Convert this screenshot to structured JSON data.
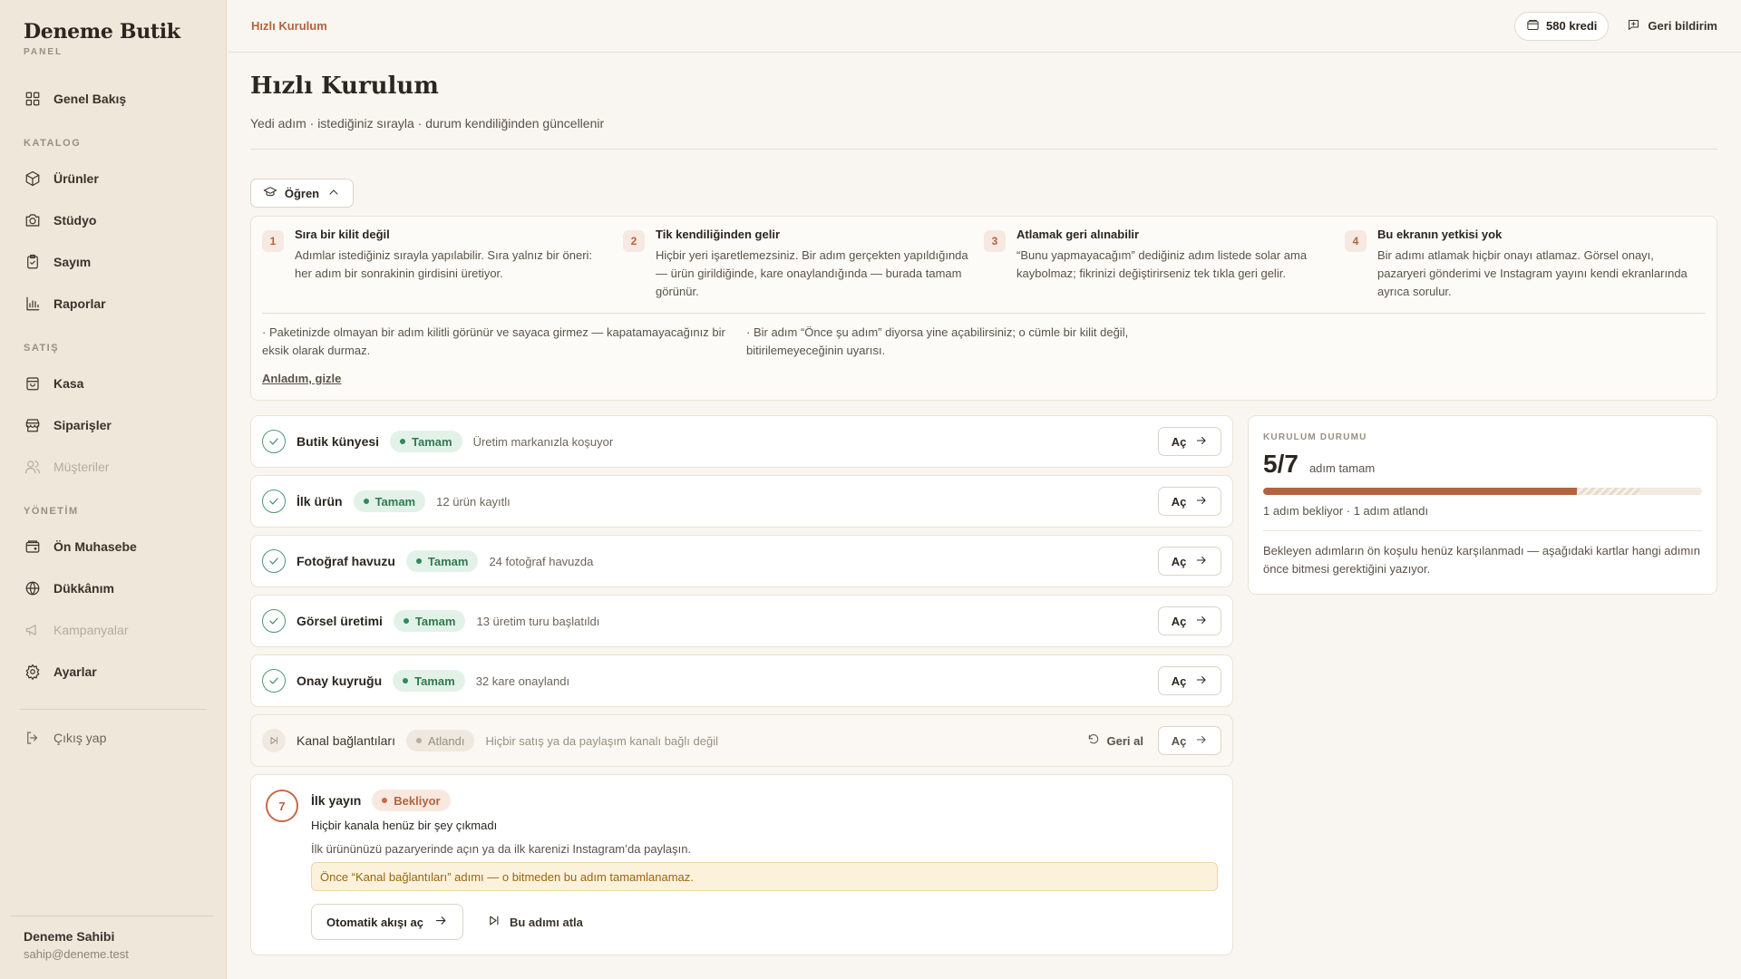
{
  "sidebar": {
    "brand_title": "Deneme Butik",
    "brand_sub": "PANEL",
    "overview": "Genel Bakış",
    "section_catalog": "KATALOG",
    "products": "Ürünler",
    "studio": "Stüdyo",
    "count": "Sayım",
    "reports": "Raporlar",
    "section_sales": "SATIŞ",
    "register": "Kasa",
    "orders": "Siparişler",
    "customers": "Müşteriler",
    "section_admin": "YÖNETİM",
    "accounting": "Ön Muhasebe",
    "shop": "Dükkânım",
    "campaigns": "Kampanyalar",
    "settings": "Ayarlar",
    "logout": "Çıkış yap",
    "user_name": "Deneme Sahibi",
    "user_email": "sahip@deneme.test"
  },
  "topbar": {
    "breadcrumb": "Hızlı Kurulum",
    "credits": "580 kredi",
    "feedback": "Geri bildirim"
  },
  "header": {
    "title": "Hızlı Kurulum",
    "subtitle": "Yedi adım · istediğiniz sırayla · durum kendiliğinden güncellenir"
  },
  "learn": {
    "button": "Öğren",
    "tips": [
      {
        "num": "1",
        "title": "Sıra bir kilit değil",
        "body": "Adımlar istediğiniz sırayla yapılabilir. Sıra yalnız bir öneri: her adım bir sonrakinin girdisini üretiyor."
      },
      {
        "num": "2",
        "title": "Tik kendiliğinden gelir",
        "body": "Hiçbir yeri işaretlemezsiniz. Bir adım gerçekten yapıldığında — ürün girildiğinde, kare onaylandığında — burada tamam görünür."
      },
      {
        "num": "3",
        "title": "Atlamak geri alınabilir",
        "body": "“Bunu yapmayacağım” dediğiniz adım listede solar ama kaybolmaz; fikrinizi değiştirirseniz tek tıkla geri gelir."
      },
      {
        "num": "4",
        "title": "Bu ekranın yetkisi yok",
        "body": "Bir adımı atlamak hiçbir onayı atlamaz. Görsel onayı, pazaryeri gönderimi ve Instagram yayını kendi ekranlarında ayrıca sorulur."
      }
    ],
    "notes": [
      "· Paketinizde olmayan bir adım kilitli görünür ve sayaca girmez — kapatamayacağınız bir eksik olarak durmaz.",
      "· Bir adım “Önce şu adım” diyorsa yine açabilirsiniz; o cümle bir kilit değil, bitirilemeyeceğinin uyarısı."
    ],
    "hide": "Anladım, gizle"
  },
  "steps": [
    {
      "title": "Butik künyesi",
      "badge": "Tamam",
      "desc": "Üretim markanızla koşuyor",
      "open": "Aç"
    },
    {
      "title": "İlk ürün",
      "badge": "Tamam",
      "desc": "12 ürün kayıtlı",
      "open": "Aç"
    },
    {
      "title": "Fotoğraf havuzu",
      "badge": "Tamam",
      "desc": "24 fotoğraf havuzda",
      "open": "Aç"
    },
    {
      "title": "Görsel üretimi",
      "badge": "Tamam",
      "desc": "13 üretim turu başlatıldı",
      "open": "Aç"
    },
    {
      "title": "Onay kuyruğu",
      "badge": "Tamam",
      "desc": "32 kare onaylandı",
      "open": "Aç"
    },
    {
      "title": "Kanal bağlantıları",
      "badge": "Atlandı",
      "desc": "Hiçbir satış ya da paylaşım kanalı bağlı değil",
      "undo": "Geri al",
      "open": "Aç"
    }
  ],
  "pending_step": {
    "num": "7",
    "title": "İlk yayın",
    "badge": "Bekliyor",
    "line1": "Hiçbir kanala henüz bir şey çıkmadı",
    "line2": "İlk ürününüzü pazaryerinde açın ya da ilk karenizi Instagram’da paylaşın.",
    "warning": "Önce “Kanal bağlantıları” adımı — o bitmeden bu adım tamamlanamaz.",
    "auto_button": "Otomatik akışı aç",
    "skip_button": "Bu adımı atla"
  },
  "status": {
    "label": "KURULUM DURUMU",
    "count": "5/7",
    "count_text": "adım tamam",
    "done": 5,
    "skipped": 1,
    "total": 7,
    "meta": "1 adım bekliyor · 1 adım atlandı",
    "note": "Bekleyen adımların ön koşulu henüz karşılanmadı — aşağıdaki kartlar hangi adımın önce bitmesi gerektiğini yazıyor."
  },
  "colors": {
    "accent": "#b3633f",
    "success": "#2f7a4f",
    "warning": "#9a6412",
    "sidebar_bg": "#efe7da"
  }
}
